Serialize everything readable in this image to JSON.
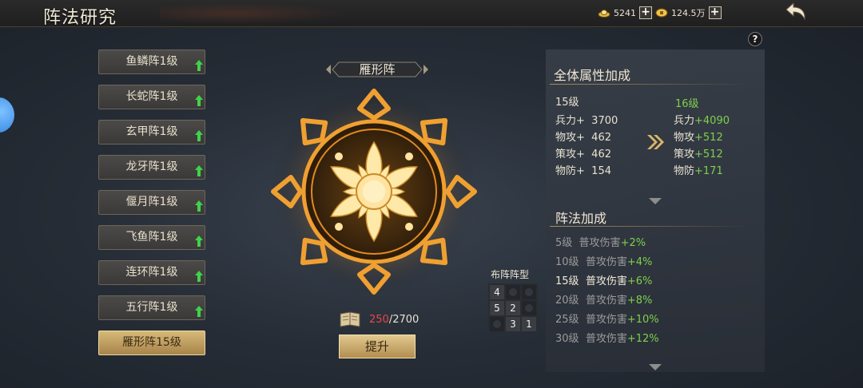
{
  "header": {
    "title": "阵法研究",
    "currency1": {
      "value": "5241",
      "icon": "silver-ingot-icon"
    },
    "currency2": {
      "value": "124.5万",
      "icon": "gold-coin-icon"
    }
  },
  "formations": [
    {
      "label": "鱼鳞阵1级",
      "upgradable": true
    },
    {
      "label": "长蛇阵1级",
      "upgradable": true
    },
    {
      "label": "玄甲阵1级",
      "upgradable": true
    },
    {
      "label": "龙牙阵1级",
      "upgradable": true
    },
    {
      "label": "偃月阵1级",
      "upgradable": true
    },
    {
      "label": "飞鱼阵1级",
      "upgradable": true
    },
    {
      "label": "连环阵1级",
      "upgradable": true
    },
    {
      "label": "五行阵1级",
      "upgradable": true
    },
    {
      "label": "雁形阵15级",
      "upgradable": false,
      "active": true
    }
  ],
  "center": {
    "name": "雁形阵",
    "exp_current": "250",
    "exp_sep": "/",
    "exp_max": "2700",
    "upgrade_label": "提升"
  },
  "layout_grid": {
    "label": "布阵阵型",
    "cells": [
      "4",
      "",
      "",
      "5",
      "2",
      "",
      "",
      "3",
      "1"
    ]
  },
  "attributes": {
    "title": "全体属性加成",
    "current_level": "15级",
    "next_level": "16级",
    "rows": [
      {
        "name": "兵力+",
        "value": "3700",
        "next_name": "兵力",
        "next_value": "+4090"
      },
      {
        "name": "物攻+",
        "value": "462",
        "next_name": "物攻",
        "next_value": "+512"
      },
      {
        "name": "策攻+",
        "value": "462",
        "next_name": "策攻",
        "next_value": "+512"
      },
      {
        "name": "物防+",
        "value": "154",
        "next_name": "物防",
        "next_value": "+171"
      }
    ]
  },
  "bonuses": {
    "title": "阵法加成",
    "rows": [
      {
        "level": "5级",
        "text": "普攻伤害",
        "value": "+2%"
      },
      {
        "level": "10级",
        "text": "普攻伤害",
        "value": "+4%"
      },
      {
        "level": "15级",
        "text": "普攻伤害",
        "value": "+6%"
      },
      {
        "level": "20级",
        "text": "普攻伤害",
        "value": "+8%"
      },
      {
        "level": "25级",
        "text": "普攻伤害",
        "value": "+10%"
      },
      {
        "level": "30级",
        "text": "普攻伤害",
        "value": "+12%"
      }
    ]
  },
  "colors": {
    "accent_gold": "#d6b979",
    "bonus_green": "#7fd04e",
    "exp_red": "#e8484a"
  }
}
